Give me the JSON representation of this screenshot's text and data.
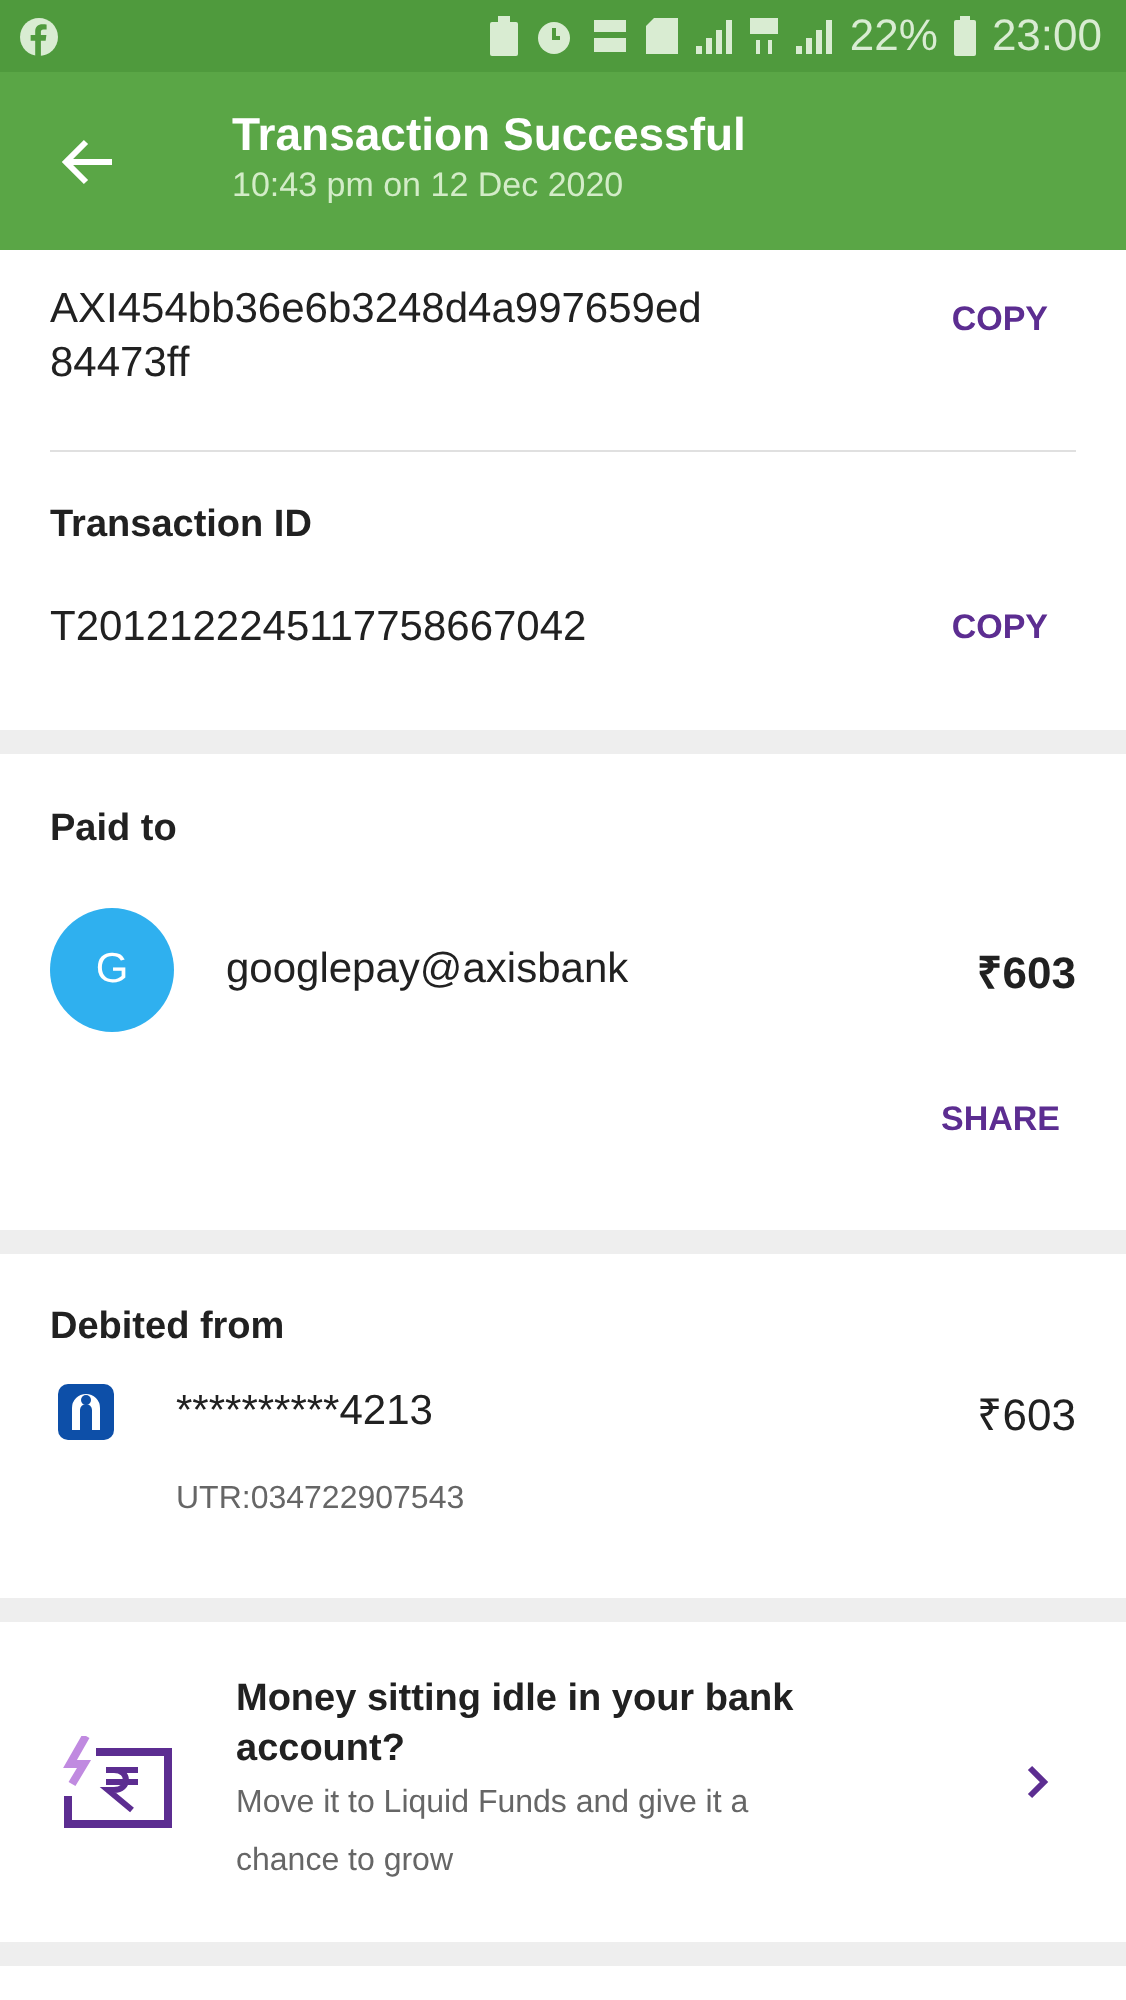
{
  "status_bar": {
    "battery": "22%",
    "time": "23:00"
  },
  "header": {
    "title": "Transaction Successful",
    "subtitle": "10:43 pm on 12 Dec 2020"
  },
  "reference": {
    "value": "AXI454bb36e6b3248d4a997659ed\n84473ff",
    "action": "COPY"
  },
  "transaction": {
    "label": "Transaction ID",
    "value": "T2012122245117758667042",
    "action": "COPY"
  },
  "paid_to": {
    "label": "Paid to",
    "avatar": "G",
    "name": "googlepay@axisbank",
    "amount": "₹603",
    "action": "SHARE"
  },
  "debited_from": {
    "label": "Debited from",
    "account": "**********4213",
    "amount": "₹603",
    "utr": "UTR:034722907543"
  },
  "promo": {
    "title": "Money sitting idle in your bank account?",
    "text": "Move it to Liquid Funds and give it a chance to grow"
  }
}
